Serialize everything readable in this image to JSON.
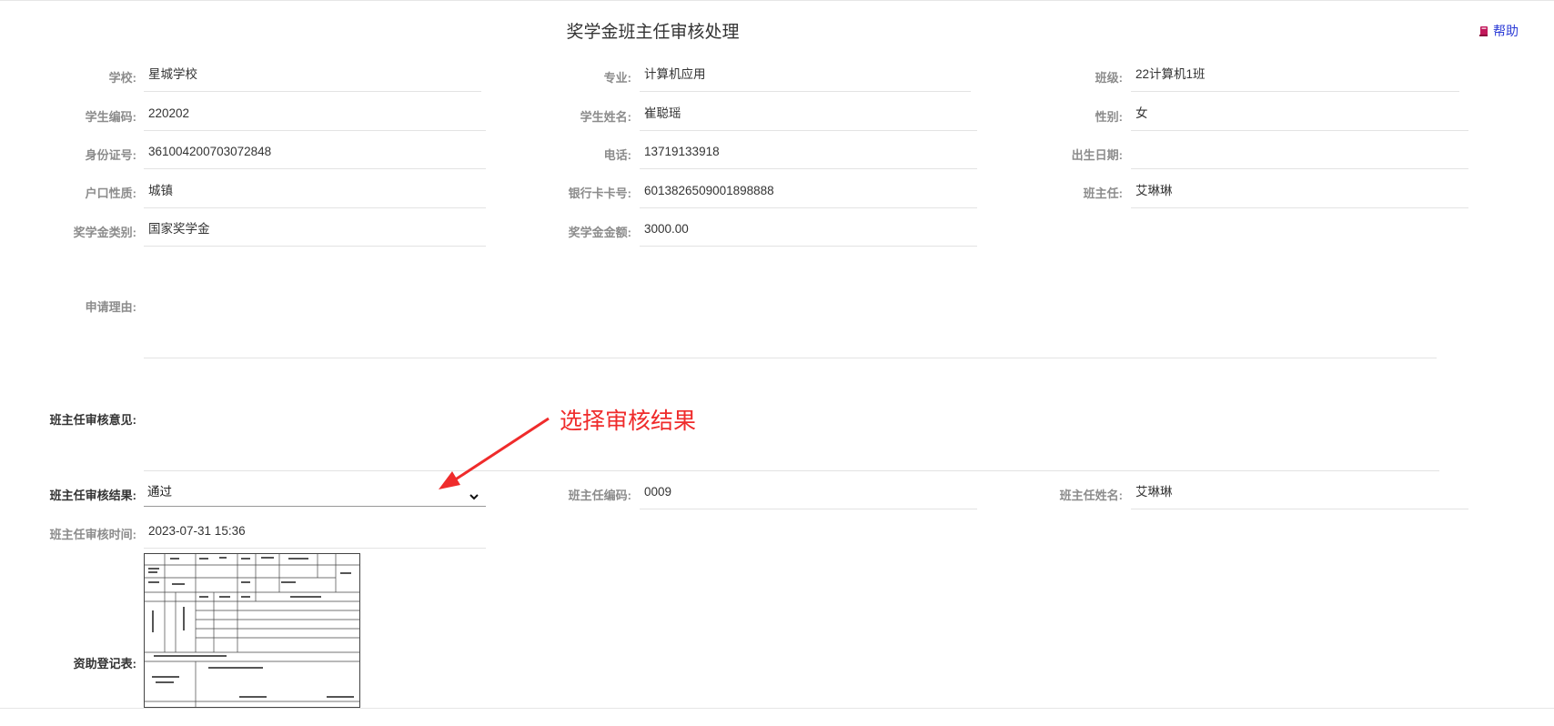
{
  "page": {
    "title": "奖学金班主任审核处理",
    "help_label": "帮助"
  },
  "fields": {
    "school": {
      "label": "学校:",
      "value": "星城学校"
    },
    "major": {
      "label": "专业:",
      "value": "计算机应用"
    },
    "class": {
      "label": "班级:",
      "value": "22计算机1班"
    },
    "student_code": {
      "label": "学生编码:",
      "value": "220202"
    },
    "student_name": {
      "label": "学生姓名:",
      "value": "崔聪瑶"
    },
    "gender": {
      "label": "性别:",
      "value": "女"
    },
    "id_number": {
      "label": "身份证号:",
      "value": "361004200703072848"
    },
    "phone": {
      "label": "电话:",
      "value": "13719133918"
    },
    "birth_date": {
      "label": "出生日期:",
      "value": ""
    },
    "household": {
      "label": "户口性质:",
      "value": "城镇"
    },
    "bank_card": {
      "label": "银行卡卡号:",
      "value": "6013826509001898888"
    },
    "head_teacher": {
      "label": "班主任:",
      "value": "艾琳琳"
    },
    "scholarship_type": {
      "label": "奖学金类别:",
      "value": "国家奖学金"
    },
    "scholarship_amount": {
      "label": "奖学金金额:",
      "value": "3000.00"
    },
    "apply_reason": {
      "label": "申请理由:",
      "value": ""
    }
  },
  "review": {
    "opinion_label": "班主任审核意见:",
    "opinion_value": "",
    "result_label": "班主任审核结果:",
    "result_value": "通过",
    "teacher_code_label": "班主任编码:",
    "teacher_code_value": "0009",
    "teacher_name_label": "班主任姓名:",
    "teacher_name_value": "艾琳琳",
    "time_label": "班主任审核时间:",
    "time_value": "2023-07-31 15:36",
    "form_label": "资助登记表:"
  },
  "annotation": {
    "text": "选择审核结果",
    "color": "#ef2b2b"
  },
  "colors": {
    "label_gray": "#8c8c8c",
    "help_link": "#2b3bd6",
    "help_icon": "#c2185b"
  },
  "icons": {
    "help": "book-icon",
    "dropdown": "chevron-down-icon"
  }
}
